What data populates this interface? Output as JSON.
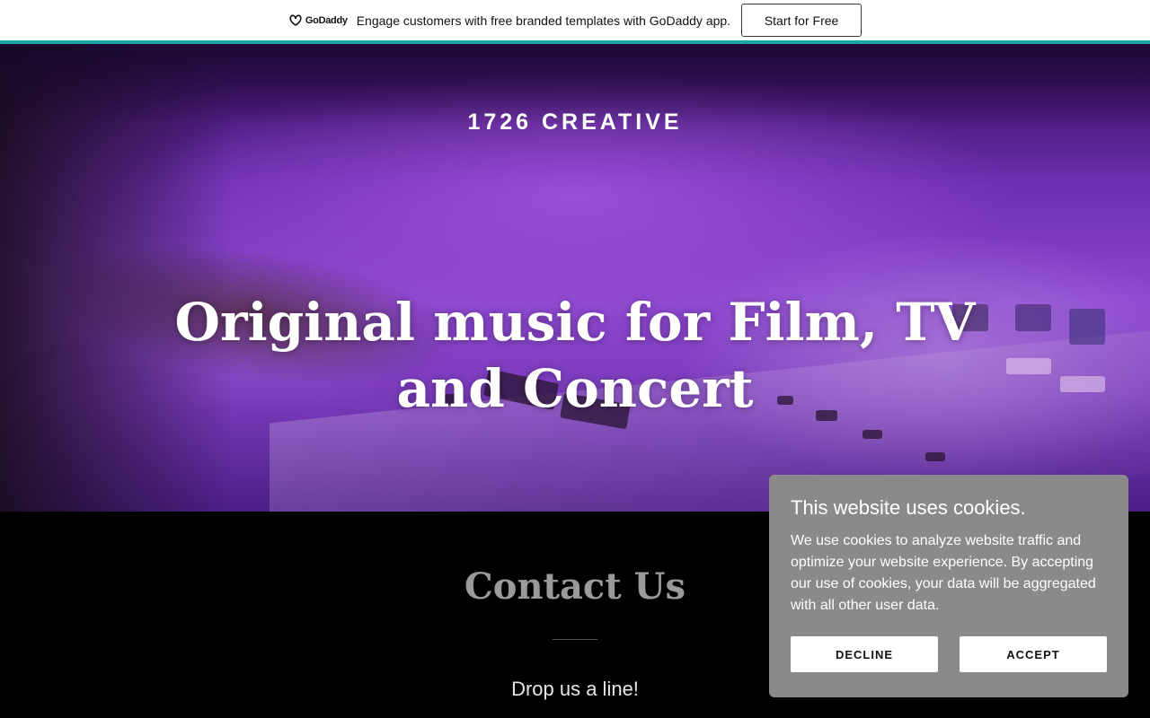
{
  "promo": {
    "logo_text": "GoDaddy",
    "message": "Engage customers with free branded templates with GoDaddy app.",
    "cta_label": "Start for Free",
    "accent_color": "#1ba6a6"
  },
  "hero": {
    "brand": "1726 CREATIVE",
    "title_line1": "Original music for Film, TV",
    "title_line2": "and Concert",
    "background_theme": "purple mixing console"
  },
  "contact": {
    "title": "Contact Us",
    "subtitle": "Drop us a line!"
  },
  "cookie_banner": {
    "title": "This website uses cookies.",
    "text": "We use cookies to analyze website traffic and optimize your website experience. By accepting our use of cookies, your data will be aggregated with all other user data.",
    "decline_label": "DECLINE",
    "accept_label": "ACCEPT"
  }
}
